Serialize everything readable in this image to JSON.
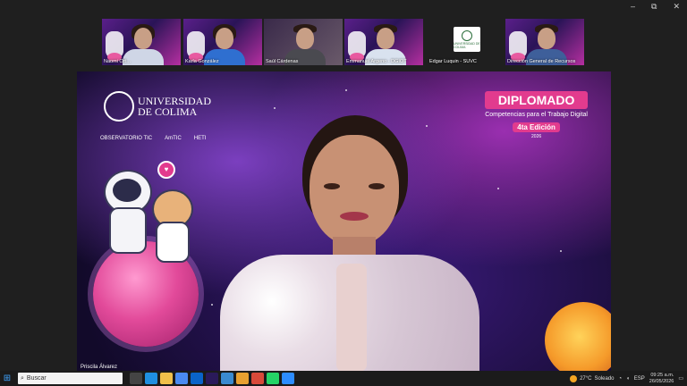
{
  "window_controls": {
    "minimize": "–",
    "restore": "⧉",
    "close": "✕"
  },
  "participants": [
    {
      "name": "Naomi Ort…",
      "type": "video"
    },
    {
      "name": "Karla González",
      "type": "video"
    },
    {
      "name": "Saúl Cárdenas",
      "type": "video"
    },
    {
      "name": "Emmanuel Argeno - DGIOT",
      "type": "video"
    },
    {
      "name": "Edgar Luquin - SUVC",
      "type": "logo",
      "logo_text": "UNIVERSIDAD DE COLIMA"
    },
    {
      "name": "Dirección General de Recursos",
      "type": "video"
    }
  ],
  "stage": {
    "university": {
      "line1": "UNIVERSIDAD",
      "line2": "DE COLIMA"
    },
    "partners": [
      "OBSERVATORIO TIC",
      "AmTIC",
      "HETI"
    ],
    "program": {
      "title": "DIPLOMADO",
      "subtitle": "Competencias para el Trabajo Digital",
      "edition": "4ta Edición",
      "year": "2026"
    },
    "speaker_name": "Priscila Álvarez"
  },
  "taskbar": {
    "search_placeholder": "Buscar",
    "weather_temp": "27°C",
    "weather_text": "Soleado",
    "lang": "ESP",
    "time": "09:25 a.m.",
    "date": "26/05/2026"
  },
  "colors": {
    "accent": "#e23b8e",
    "taskbar": "#1b1b1b"
  }
}
